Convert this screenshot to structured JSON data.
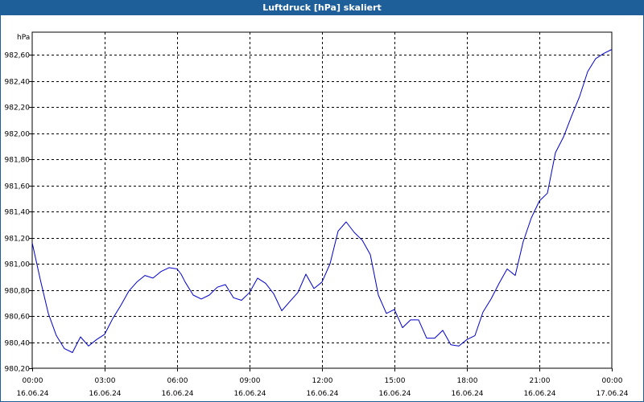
{
  "window": {
    "title": "Luftdruck [hPa] skaliert"
  },
  "chart_data": {
    "type": "line",
    "title": "Luftdruck [hPa] skaliert",
    "ylabel": "hPa",
    "xlabel": "",
    "ylim": [
      980.2,
      982.7
    ],
    "grid": true,
    "y_ticks": [
      "980,20",
      "980,40",
      "980,60",
      "980,80",
      "981,00",
      "981,20",
      "981,40",
      "981,60",
      "981,80",
      "982,00",
      "982,20",
      "982,40",
      "982,60"
    ],
    "x_ticks": [
      {
        "time": "00:00",
        "date": "16.06.24"
      },
      {
        "time": "03:00",
        "date": "16.06.24"
      },
      {
        "time": "06:00",
        "date": "16.06.24"
      },
      {
        "time": "09:00",
        "date": "16.06.24"
      },
      {
        "time": "12:00",
        "date": "16.06.24"
      },
      {
        "time": "15:00",
        "date": "16.06.24"
      },
      {
        "time": "18:00",
        "date": "16.06.24"
      },
      {
        "time": "21:00",
        "date": "16.06.24"
      },
      {
        "time": "00:00",
        "date": "17.06.24"
      }
    ],
    "series": [
      {
        "color": "#0000cc",
        "x": [
          "16.06.24 00:00",
          "16.06.24 00:20",
          "16.06.24 00:40",
          "16.06.24 01:00",
          "16.06.24 01:20",
          "16.06.24 01:40",
          "16.06.24 02:00",
          "16.06.24 02:20",
          "16.06.24 02:40",
          "16.06.24 03:00",
          "16.06.24 03:10",
          "16.06.24 03:20",
          "16.06.24 03:40",
          "16.06.24 04:00",
          "16.06.24 04:20",
          "16.06.24 04:40",
          "16.06.24 05:00",
          "16.06.24 05:20",
          "16.06.24 05:40",
          "16.06.24 06:00",
          "16.06.24 06:10",
          "16.06.24 06:20",
          "16.06.24 06:40",
          "16.06.24 07:00",
          "16.06.24 07:20",
          "16.06.24 07:40",
          "16.06.24 08:00",
          "16.06.24 08:20",
          "16.06.24 08:40",
          "16.06.24 09:00",
          "16.06.24 09:20",
          "16.06.24 09:40",
          "16.06.24 10:00",
          "16.06.24 10:20",
          "16.06.24 10:40",
          "16.06.24 11:00",
          "16.06.24 11:20",
          "16.06.24 11:40",
          "16.06.24 12:00",
          "16.06.24 12:20",
          "16.06.24 12:40",
          "16.06.24 13:00",
          "16.06.24 13:20",
          "16.06.24 13:40",
          "16.06.24 14:00",
          "16.06.24 14:20",
          "16.06.24 14:40",
          "16.06.24 15:00",
          "16.06.24 15:20",
          "16.06.24 15:40",
          "16.06.24 16:00",
          "16.06.24 16:20",
          "16.06.24 16:40",
          "16.06.24 17:00",
          "16.06.24 17:20",
          "16.06.24 17:40",
          "16.06.24 18:00",
          "16.06.24 18:20",
          "16.06.24 18:40",
          "16.06.24 19:00",
          "16.06.24 19:20",
          "16.06.24 19:40",
          "16.06.24 20:00",
          "16.06.24 20:20",
          "16.06.24 20:40",
          "16.06.24 21:00",
          "16.06.24 21:20",
          "16.06.24 21:40",
          "16.06.24 22:00",
          "16.06.24 22:20",
          "16.06.24 22:40",
          "16.06.24 23:00",
          "16.06.24 23:20",
          "16.06.24 23:40",
          "17.06.24 00:00"
        ],
        "values": [
          981.16,
          980.88,
          980.62,
          980.45,
          980.35,
          980.32,
          980.44,
          980.37,
          980.42,
          980.46,
          980.52,
          980.58,
          980.68,
          980.79,
          980.86,
          980.91,
          980.89,
          980.94,
          980.97,
          980.96,
          980.92,
          980.86,
          980.76,
          980.73,
          980.76,
          980.82,
          980.84,
          980.74,
          980.72,
          980.78,
          980.89,
          980.85,
          980.77,
          980.64,
          980.71,
          980.78,
          980.92,
          980.81,
          980.86,
          981.0,
          981.25,
          981.32,
          981.24,
          981.18,
          981.07,
          980.76,
          980.62,
          980.65,
          980.51,
          980.57,
          980.57,
          980.43,
          980.43,
          980.49,
          980.38,
          980.37,
          980.42,
          980.45,
          980.63,
          980.73,
          980.85,
          980.96,
          980.91,
          981.17,
          981.35,
          981.48,
          981.54,
          981.85,
          981.97,
          982.13,
          982.28,
          982.47,
          982.57,
          982.61,
          982.64
        ]
      }
    ]
  }
}
